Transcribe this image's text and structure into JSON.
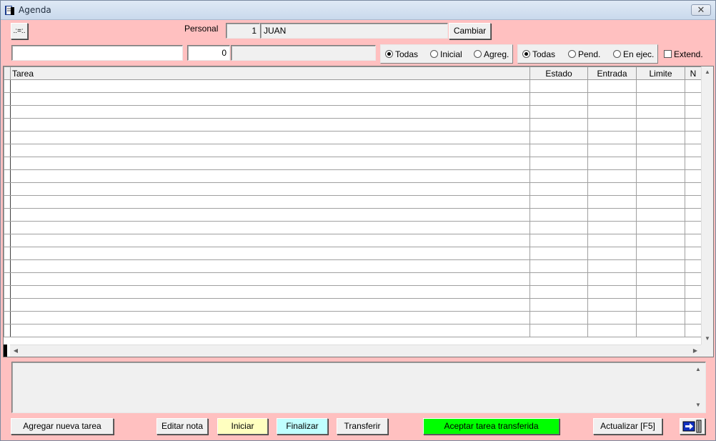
{
  "window": {
    "title": "Agenda",
    "close_glyph": "✕"
  },
  "toolbar": {
    "menu_button": ".:=:."
  },
  "personal": {
    "label": "Personal",
    "id": "1",
    "name": "JUAN",
    "change_button": "Cambiar"
  },
  "filter": {
    "text_value": "",
    "number_value": "0",
    "desc_value": ""
  },
  "origin_group": {
    "options": [
      "Todas",
      "Inicial",
      "Agreg."
    ],
    "selected": "Todas"
  },
  "status_group": {
    "options": [
      "Todas",
      "Pend.",
      "En ejec."
    ],
    "selected": "Todas"
  },
  "extend": {
    "label": "Extend.",
    "checked": false
  },
  "grid": {
    "columns": [
      "Tarea",
      "Estado",
      "Entrada",
      "Limite",
      "N"
    ],
    "rows": []
  },
  "note": {
    "value": ""
  },
  "actions": {
    "add_task": "Agregar nueva tarea",
    "edit_note": "Editar nota",
    "start": "Iniciar",
    "finish": "Finalizar",
    "transfer": "Transferir",
    "accept_transfer": "Aceptar tarea transferida",
    "refresh": "Actualizar [F5]"
  },
  "colors": {
    "background": "#ffc0c0",
    "start_button": "#ffffc0",
    "finish_button": "#c0ffff",
    "accept_button": "#00ff00"
  },
  "icons": {
    "app": "agenda-book-icon",
    "exit": "exit-door-icon"
  }
}
